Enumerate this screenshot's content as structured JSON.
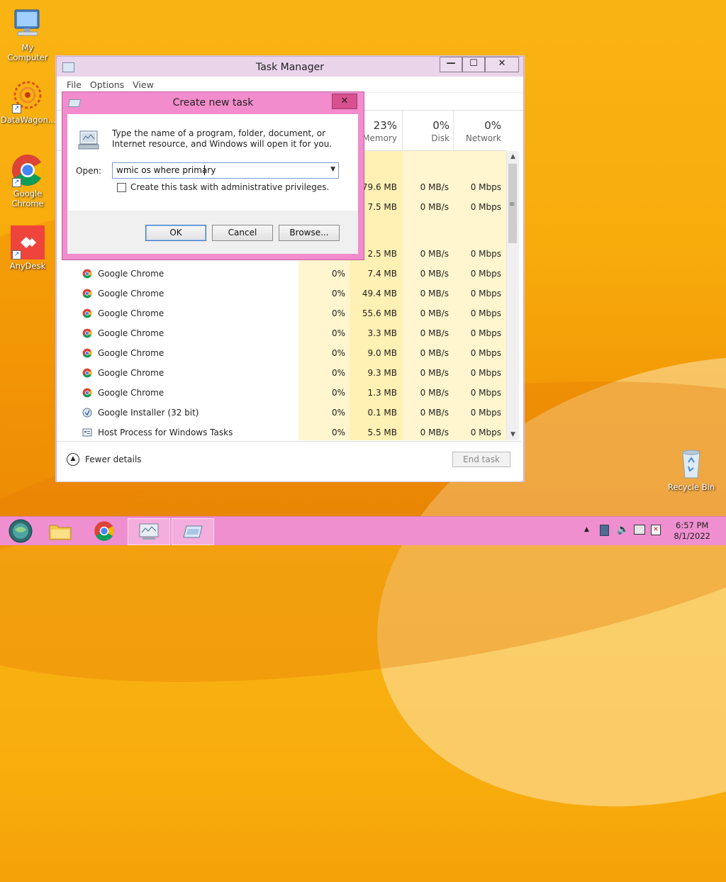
{
  "desktop": {
    "icons": [
      {
        "label": "My Computer"
      },
      {
        "label": "DataWagon..."
      },
      {
        "label": "Google Chrome"
      },
      {
        "label": "AnyDesk"
      },
      {
        "label": "Recycle Bin"
      }
    ]
  },
  "task_manager": {
    "title": "Task Manager",
    "window_buttons": {
      "minimize": "—",
      "maximize": "☐",
      "close": "✕"
    },
    "menu": [
      "File",
      "Options",
      "View"
    ],
    "columns": [
      {
        "pct": "23%",
        "label": "Memory"
      },
      {
        "pct": "0%",
        "label": "Disk"
      },
      {
        "pct": "0%",
        "label": "Network"
      }
    ],
    "partial_rows": [
      {
        "memory": "79.6 MB",
        "disk": "0 MB/s",
        "network": "0 Mbps"
      },
      {
        "memory": "7.5 MB",
        "disk": "0 MB/s",
        "network": "0 Mbps"
      },
      {
        "memory": "2.5 MB",
        "disk": "0 MB/s",
        "network": "0 Mbps"
      }
    ],
    "rows": [
      {
        "name": "Google Chrome",
        "icon": "chrome-icon",
        "cpu": "0%",
        "memory": "7.4 MB",
        "disk": "0 MB/s",
        "network": "0 Mbps"
      },
      {
        "name": "Google Chrome",
        "icon": "chrome-icon",
        "cpu": "0%",
        "memory": "49.4 MB",
        "disk": "0 MB/s",
        "network": "0 Mbps"
      },
      {
        "name": "Google Chrome",
        "icon": "chrome-icon",
        "cpu": "0%",
        "memory": "55.6 MB",
        "disk": "0 MB/s",
        "network": "0 Mbps"
      },
      {
        "name": "Google Chrome",
        "icon": "chrome-icon",
        "cpu": "0%",
        "memory": "3.3 MB",
        "disk": "0 MB/s",
        "network": "0 Mbps"
      },
      {
        "name": "Google Chrome",
        "icon": "chrome-icon",
        "cpu": "0%",
        "memory": "9.0 MB",
        "disk": "0 MB/s",
        "network": "0 Mbps"
      },
      {
        "name": "Google Chrome",
        "icon": "chrome-icon",
        "cpu": "0%",
        "memory": "9.3 MB",
        "disk": "0 MB/s",
        "network": "0 Mbps"
      },
      {
        "name": "Google Chrome",
        "icon": "chrome-icon",
        "cpu": "0%",
        "memory": "1.3 MB",
        "disk": "0 MB/s",
        "network": "0 Mbps"
      },
      {
        "name": "Google Installer (32 bit)",
        "icon": "installer-icon",
        "cpu": "0%",
        "memory": "0.1 MB",
        "disk": "0 MB/s",
        "network": "0 Mbps"
      },
      {
        "name": "Host Process for Windows Tasks",
        "icon": "host-process-icon",
        "cpu": "0%",
        "memory": "5.5 MB",
        "disk": "0 MB/s",
        "network": "0 Mbps"
      }
    ],
    "fewer_details": "Fewer details",
    "end_task": "End task"
  },
  "run_dialog": {
    "title": "Create new task",
    "close": "✕",
    "message": "Type the name of a program, folder, document, or Internet resource, and Windows will open it for you.",
    "open_label": "Open:",
    "open_value": "wmic os where primary",
    "admin_checkbox": "Create this task with administrative privileges.",
    "buttons": {
      "ok": "OK",
      "cancel": "Cancel",
      "browse": "Browse..."
    }
  },
  "taskbar": {
    "items": [
      "start-icon",
      "file-explorer-icon",
      "chrome-icon",
      "task-manager-icon",
      "run-dialog-icon"
    ],
    "clock": {
      "time": "6:57 PM",
      "date": "8/1/2022"
    }
  },
  "colors": {
    "accent": "#ef8fd0",
    "dialog_frame": "#f28ccd",
    "cpu_column": "#fff5cc",
    "memory_column": "#fff1b8"
  }
}
